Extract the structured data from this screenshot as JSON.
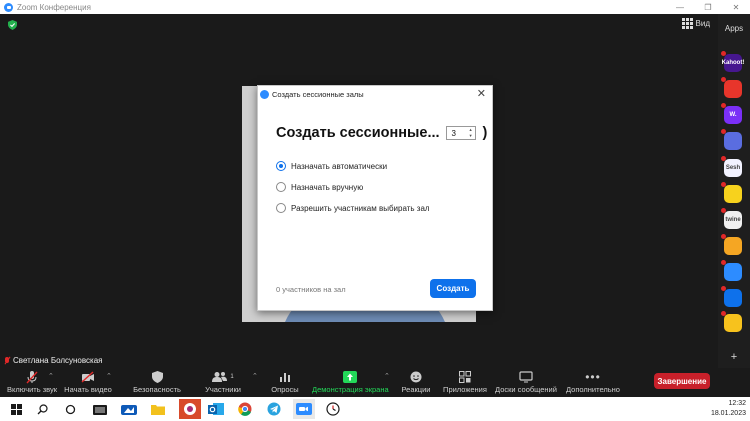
{
  "window": {
    "title": "Zoom Конференция"
  },
  "meeting": {
    "view_label": "Вид",
    "speaker_name": "Светлана Болсуновская"
  },
  "apps": {
    "label": "Apps",
    "items": [
      {
        "name": "kahoot",
        "text": "Kahoot!",
        "color": "#46178f"
      },
      {
        "name": "red-app",
        "text": "",
        "color": "#e8352b"
      },
      {
        "name": "wooclap",
        "text": "W.",
        "color": "#7b2ff7"
      },
      {
        "name": "circle-app",
        "text": "",
        "color": "#5a6de0"
      },
      {
        "name": "sesh",
        "text": "Sesh",
        "color": "#f2f2ff"
      },
      {
        "name": "smiley",
        "text": "",
        "color": "#f7d21d"
      },
      {
        "name": "twine",
        "text": "twine",
        "color": "#f0f0f0"
      },
      {
        "name": "grid-app",
        "text": "",
        "color": "#f5a623"
      },
      {
        "name": "sync-app",
        "text": "",
        "color": "#2d8cff"
      },
      {
        "name": "blue-app",
        "text": "",
        "color": "#0e71eb"
      },
      {
        "name": "yellow-app",
        "text": "",
        "color": "#f7c21d"
      }
    ],
    "more": "+"
  },
  "toolbar": {
    "unmute": "Включить звук",
    "start_video": "Начать видео",
    "security": "Безопасность",
    "participants": "Участники",
    "participants_count": "1",
    "polls": "Опросы",
    "share_screen": "Демонстрация экрана",
    "reactions": "Реакции",
    "apps": "Приложения",
    "whiteboards": "Доски сообщений",
    "more": "Дополнительно",
    "end": "Завершение"
  },
  "dialog": {
    "title": "Создать сессионные залы",
    "heading": "Создать сессионные...",
    "room_count": "3",
    "heading_paren": ")",
    "options": [
      {
        "label": "Назначать автоматически",
        "checked": true
      },
      {
        "label": "Назначать вручную",
        "checked": false
      },
      {
        "label": "Разрешить участникам выбирать зал",
        "checked": false
      }
    ],
    "footer_text": "0 участников на зал",
    "create_button": "Создать"
  },
  "taskbar": {
    "time": "12:32",
    "date": "18.01.2023"
  },
  "colors": {
    "accent": "#0e71eb",
    "end_button": "#c8202a",
    "share_green": "#23d959"
  }
}
